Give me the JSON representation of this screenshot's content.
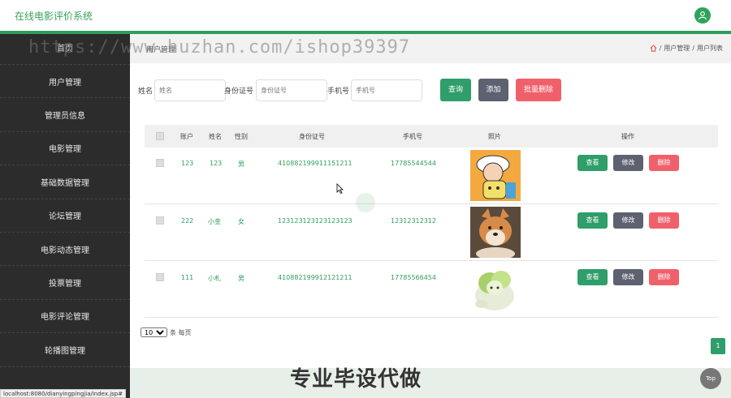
{
  "header": {
    "title": "在线电影评价系统"
  },
  "sidebar": {
    "home": "首页",
    "items": [
      {
        "label": "用户管理"
      },
      {
        "label": "管理员信息"
      },
      {
        "label": "电影管理"
      },
      {
        "label": "基础数据管理"
      },
      {
        "label": "论坛管理"
      },
      {
        "label": "电影动态管理"
      },
      {
        "label": "投票管理"
      },
      {
        "label": "电影评论管理"
      },
      {
        "label": "轮播图管理"
      }
    ]
  },
  "page": {
    "title": "用户管理",
    "breadcrumb": [
      "用户管理",
      "用户列表"
    ]
  },
  "search": {
    "name_label": "姓名",
    "name_placeholder": "姓名",
    "id_label": "身份证号",
    "id_placeholder": "身份证号",
    "phone_label": "手机号",
    "phone_placeholder": "手机号",
    "query_btn": "查询",
    "add_btn": "添加",
    "batch_delete_btn": "批量删除"
  },
  "table": {
    "headers": [
      "账户",
      "姓名",
      "性别",
      "身份证号",
      "手机号",
      "照片",
      "操作"
    ],
    "rows": [
      {
        "account": "123",
        "name": "123",
        "gender": "男",
        "id_no": "410882199911151211",
        "phone": "17785544544",
        "photo": "cartoon-boy"
      },
      {
        "account": "222",
        "name": "小金",
        "gender": "女",
        "id_no": "123123123123123123",
        "phone": "12312312312",
        "photo": "shiba-dog"
      },
      {
        "account": "111",
        "name": "小札",
        "gender": "男",
        "id_no": "410882199912121211",
        "phone": "17785566454",
        "photo": "cabbage-dog"
      }
    ],
    "actions": {
      "view": "查看",
      "edit": "修改",
      "delete": "删除"
    }
  },
  "pagination": {
    "page_size": "10",
    "suffix": "条 每页",
    "current_page": "1"
  },
  "overlay": {
    "watermark": "https://www.huzhan.com/ishop39397",
    "slogan": "专业毕设代做",
    "top_button": "Top",
    "status_url": "localhost:8080/dianyingpingjia/index.jsp#"
  },
  "colors": {
    "accent": "#2f9e5a",
    "sidebar": "#2c2c2c",
    "danger": "#f0606b",
    "neutral": "#5d6170"
  }
}
